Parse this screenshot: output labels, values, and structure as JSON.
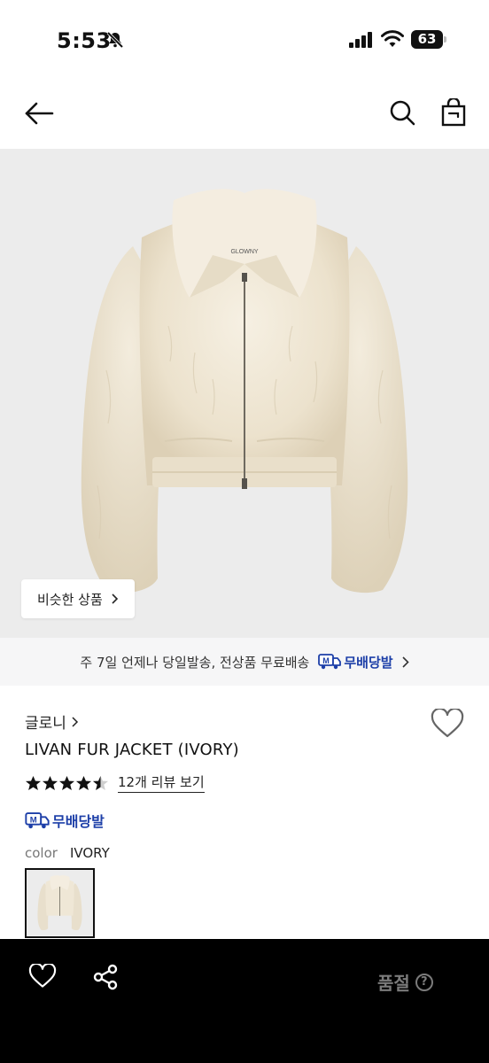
{
  "status_bar": {
    "time": "5:53",
    "battery": "63"
  },
  "header": {
    "back_icon": "arrow-left-icon",
    "search_icon": "search-icon",
    "bag_icon": "shopping-bag-icon"
  },
  "hero": {
    "similar_products_label": "비슷한 상품",
    "image_label": "GLOWNY"
  },
  "shipping_banner": {
    "text": "주 7일 언제나 당일발송, 전상품 무료배송",
    "badge_label": "무배당발"
  },
  "product": {
    "brand": "글로니",
    "name": "LIVAN FUR JACKET (IVORY)",
    "rating": 4.5,
    "review_link": "12개 리뷰 보기",
    "free_shipping_label": "무배당발",
    "color_label": "color",
    "color_value": "IVORY"
  },
  "bottom_bar": {
    "status_label": "품절",
    "help_icon": "question-circle-icon",
    "wish_icon": "heart-icon",
    "share_icon": "share-icon"
  },
  "colors": {
    "accent_blue": "#1d3fa8",
    "bottom_bar_bg": "#000000",
    "fur": "#efe7d6"
  }
}
